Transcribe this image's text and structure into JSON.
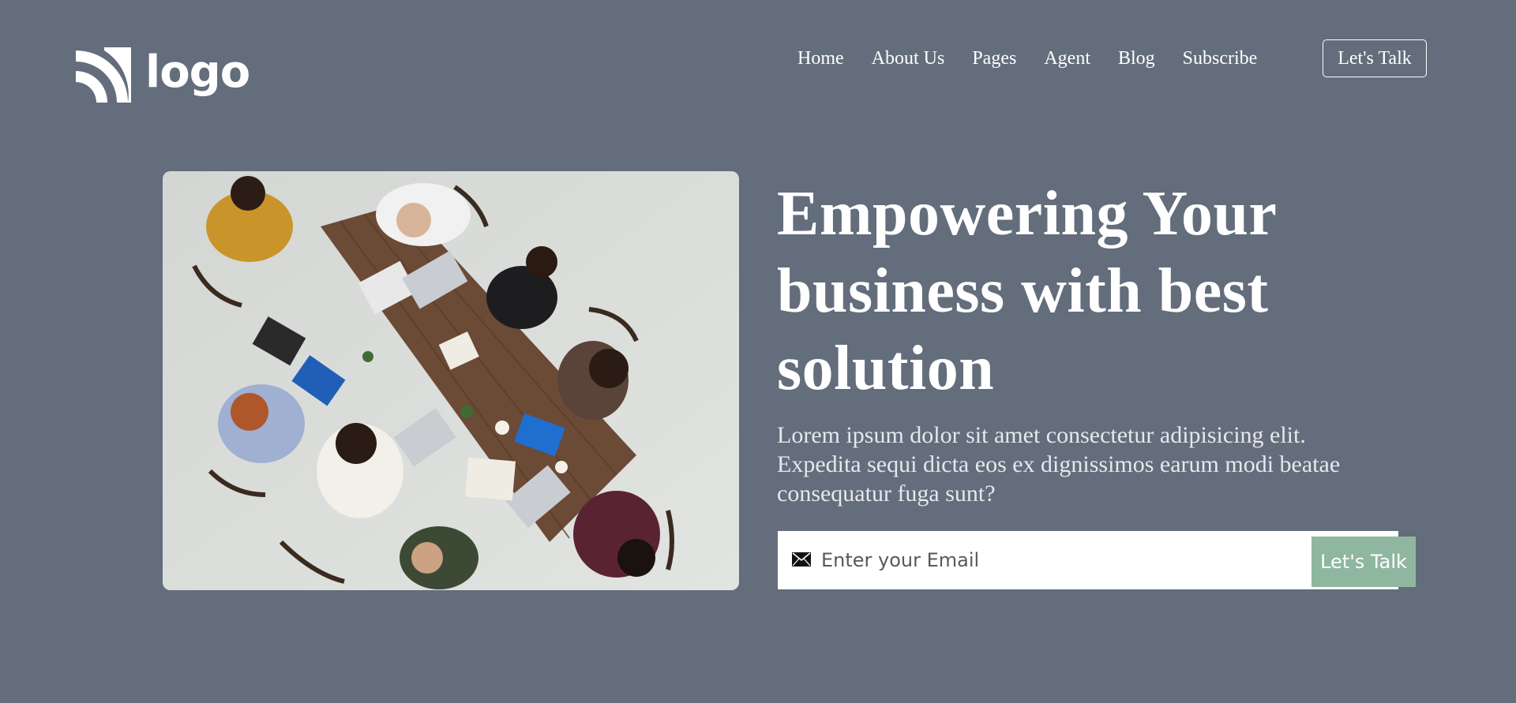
{
  "brand": {
    "logo_text": "logo",
    "logo_icon": "signal-arcs-icon"
  },
  "nav": {
    "items": [
      {
        "label": "Home"
      },
      {
        "label": "About Us"
      },
      {
        "label": "Pages"
      },
      {
        "label": "Agent"
      },
      {
        "label": "Blog"
      },
      {
        "label": "Subscribe"
      }
    ],
    "cta_label": "Let's Talk"
  },
  "hero": {
    "image_semantic": "team-meeting-photo",
    "heading": "Empowering Your business with best solution",
    "description": "Lorem ipsum dolor sit amet consectetur adipisicing elit. Expedita sequi dicta eos ex dignissimos earum modi beatae consequatur fuga sunt?"
  },
  "signup": {
    "icon": "envelope-icon",
    "placeholder": "Enter your Email",
    "button_label": "Let's Talk"
  },
  "colors": {
    "background": "#636d7b",
    "accent_button": "#8fb7a0",
    "text": "#ffffff"
  }
}
